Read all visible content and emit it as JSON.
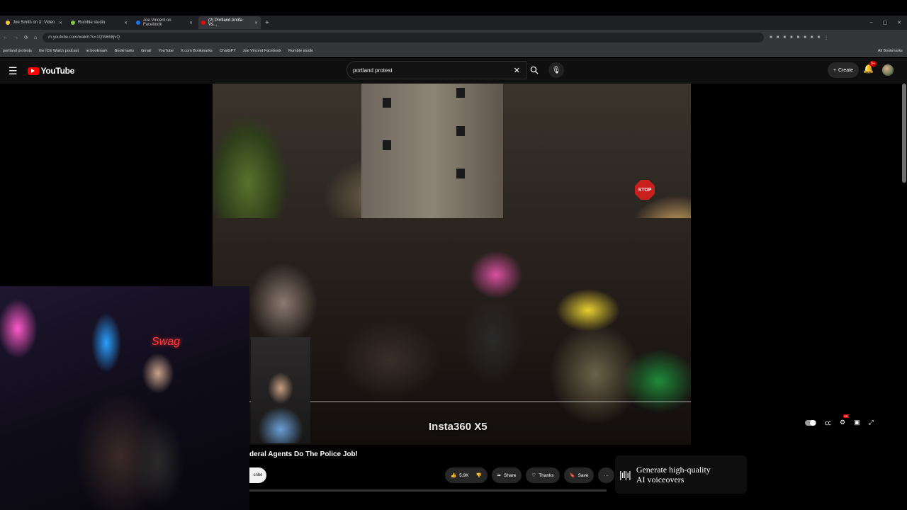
{
  "browser": {
    "tabs": [
      {
        "label": "Joe Smith on X: Video",
        "color": "#f5c542",
        "active": false
      },
      {
        "label": "Rumble studio",
        "color": "#85c742",
        "active": false
      },
      {
        "label": "Joe Vincent on Facebook",
        "color": "#1877f2",
        "active": false
      },
      {
        "label": "(2) Portland Antifa Vs...",
        "color": "#ff0000",
        "active": true
      }
    ],
    "new_tab": "+",
    "window_controls": [
      "–",
      "▢",
      "✕"
    ],
    "address": "m.youtube.com/watch?v=1QW6h8jvQ",
    "bookmarks": [
      "portland protests",
      "the ICE Watch podcast",
      "re:bookmark",
      "Bookmarks",
      "Gmail",
      "YouTube",
      "X.com Bookmarks",
      "ChatGPT",
      "Joe Vincent Facebook",
      "Rumble studio"
    ],
    "bookmarks_right": "All Bookmarks"
  },
  "youtube": {
    "logo_text": "YouTube",
    "search_value": "portland protest",
    "create_label": "Create",
    "notif_count": "9+"
  },
  "video": {
    "watermark": "Insta360 X5",
    "stop_sign": "STOP"
  },
  "stream": {
    "neon_sign": "Swag"
  },
  "below_video": {
    "title": "deral Agents Do The Police Job!",
    "subscribe_label": "cribe",
    "like_count": "5.9K",
    "share_label": "Share",
    "thanks_label": "Thanks",
    "save_label": "Save",
    "more_label": "···"
  },
  "ad": {
    "line1": "Generate high-quality",
    "line2": "AI voiceovers"
  }
}
